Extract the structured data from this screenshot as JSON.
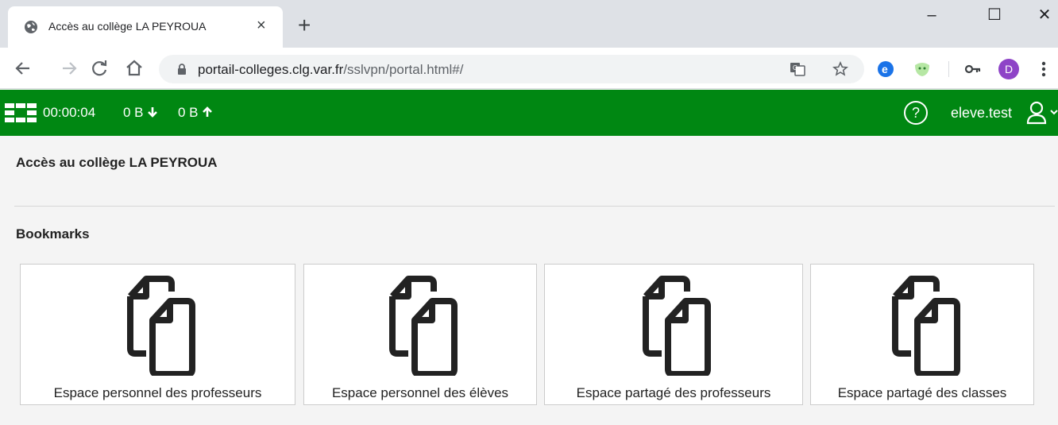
{
  "browser": {
    "tab_title": "Accès au collège LA PEYROUA",
    "tab_close": "×",
    "new_tab": "+",
    "url_host": "portail-colleges.clg.var.fr",
    "url_path": "/sslvpn/portal.html#/",
    "profile_initial": "D",
    "window_controls": {
      "minimize": "–",
      "maximize": "☐",
      "close": "✕"
    }
  },
  "header": {
    "connection_time": "00:00:04",
    "bytes_down": "0 B",
    "bytes_up": "0 B",
    "help_glyph": "?",
    "username": "eleve.test",
    "brand_color": "#008712"
  },
  "content": {
    "page_title": "Accès au collège LA PEYROUA",
    "section_title": "Bookmarks",
    "bookmarks": [
      {
        "label": "Espace personnel des professeurs",
        "icon": "copy-files-icon"
      },
      {
        "label": "Espace personnel des élèves",
        "icon": "copy-files-icon"
      },
      {
        "label": "Espace partagé des professeurs",
        "icon": "copy-files-icon"
      },
      {
        "label": "Espace partagé des classes",
        "icon": "copy-files-icon"
      }
    ]
  }
}
